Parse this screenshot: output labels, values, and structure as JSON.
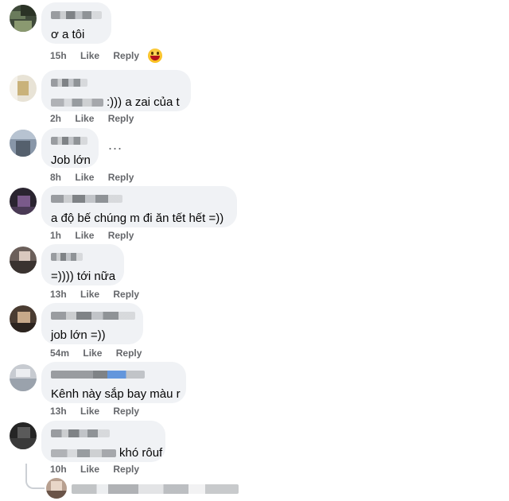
{
  "comments": [
    {
      "text": "ơ a tôi",
      "time": "15h",
      "like": "Like",
      "reply": "Reply"
    },
    {
      "text": ":))) a zai của t",
      "time": "2h",
      "like": "Like",
      "reply": "Reply"
    },
    {
      "text": "Job lớn",
      "time": "8h",
      "like": "Like",
      "reply": "Reply",
      "more": "..."
    },
    {
      "text": "a độ bế chúng m đi ăn tết hết =))",
      "time": "1h",
      "like": "Like",
      "reply": "Reply"
    },
    {
      "text": "=)))) tới nữa",
      "time": "13h",
      "like": "Like",
      "reply": "Reply"
    },
    {
      "text": "job lớn =))",
      "time": "54m",
      "like": "Like",
      "reply": "Reply"
    },
    {
      "text": "Kênh này sắp bay màu r",
      "time": "13h",
      "like": "Like",
      "reply": "Reply"
    },
    {
      "text": "khó rôuf",
      "time": "10h",
      "like": "Like",
      "reply": "Reply"
    }
  ],
  "icons": {
    "reaction": "grinning-emoji-icon",
    "more": "more-options-icon"
  },
  "colors": {
    "bubble_bg": "#f0f2f5",
    "meta_text": "#65676b"
  }
}
